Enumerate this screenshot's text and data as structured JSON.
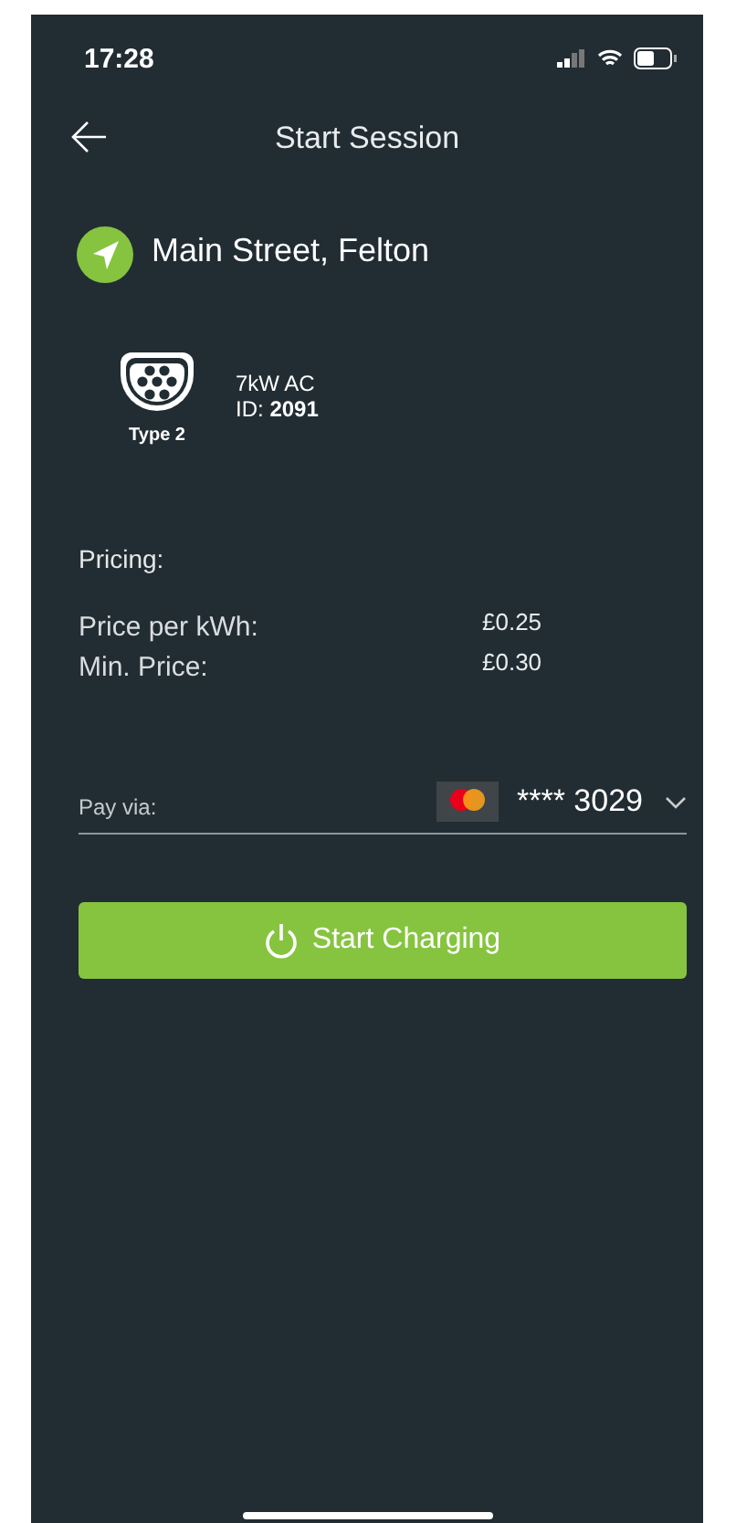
{
  "status_bar": {
    "time": "17:28"
  },
  "header": {
    "title": "Start Session"
  },
  "location": {
    "name": "Main Street, Felton"
  },
  "connector": {
    "type": "Type 2",
    "power": "7kW AC",
    "id_label": "ID:",
    "id": "2091"
  },
  "pricing": {
    "title": "Pricing:",
    "rows": [
      {
        "label": "Price per kWh:",
        "value": "£0.25"
      },
      {
        "label": "Min. Price:",
        "value": "£0.30"
      }
    ]
  },
  "payment": {
    "label": "Pay via:",
    "card": "**** 3029"
  },
  "button": {
    "label": "Start Charging"
  }
}
